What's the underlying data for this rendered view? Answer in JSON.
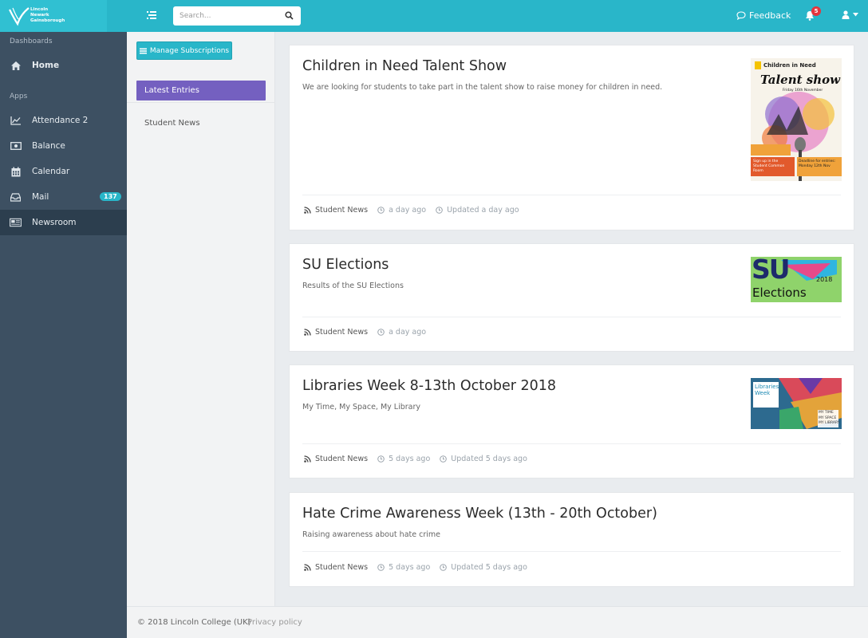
{
  "brand": {
    "lines": [
      "Lincoln",
      "Newark",
      "Gainsborough"
    ]
  },
  "header": {
    "search_placeholder": "Search...",
    "feedback_label": "Feedback",
    "notification_count": "5"
  },
  "sidebar": {
    "sections": [
      {
        "label": "Dashboards"
      },
      {
        "label": "Apps"
      }
    ],
    "items": [
      {
        "label": "Home",
        "icon": "home-icon"
      },
      {
        "label": "Attendance 2",
        "icon": "line-chart-icon"
      },
      {
        "label": "Balance",
        "icon": "money-icon"
      },
      {
        "label": "Calendar",
        "icon": "calendar-icon"
      },
      {
        "label": "Mail",
        "icon": "inbox-icon",
        "badge": "137"
      },
      {
        "label": "Newsroom",
        "icon": "newspaper-icon",
        "active": true
      }
    ]
  },
  "subnav": {
    "manage_label": "Manage Subscriptions",
    "latest_label": "Latest Entries",
    "feeds": [
      "Student News"
    ]
  },
  "entries": [
    {
      "title": "Children in Need Talent Show",
      "description": "We are looking for students to take part in the talent show to raise money for children in need.",
      "source": "Student News",
      "posted": "a day ago",
      "updated": "Updated a day ago",
      "thumb_text": {
        "top": "Children in Need",
        "main": "Talent show",
        "date": "Friday 16th November",
        "deadline": "Deadline for entries: Monday 12th Nov",
        "signup": "Sign up in the Student Common Room"
      }
    },
    {
      "title": "SU Elections",
      "description": "Results of the SU Elections",
      "source": "Student News",
      "posted": "a day ago",
      "thumb_text": {
        "big": "SU",
        "year": "2018",
        "word": "Elections"
      }
    },
    {
      "title": "Libraries Week 8-13th October 2018",
      "description": "My Time, My Space, My Library",
      "source": "Student News",
      "posted": "5 days ago",
      "updated": "Updated 5 days ago",
      "thumb_text": {
        "title": "Libraries Week",
        "tags": [
          "MY TIME",
          "MY SPACE",
          "MY LIBRARY"
        ]
      }
    },
    {
      "title": "Hate Crime Awareness Week (13th - 20th October)",
      "description": "Raising awareness about hate crime",
      "source": "Student News",
      "posted": "5 days ago",
      "updated": "Updated 5 days ago"
    }
  ],
  "footer": {
    "copyright": "© 2018 Lincoln College (UK)",
    "privacy": "Privacy policy"
  },
  "colors": {
    "topbar": "#29b6c9",
    "sidebar": "#3d5062",
    "accent_purple": "#7460c0",
    "badge_red": "#e5343d"
  }
}
